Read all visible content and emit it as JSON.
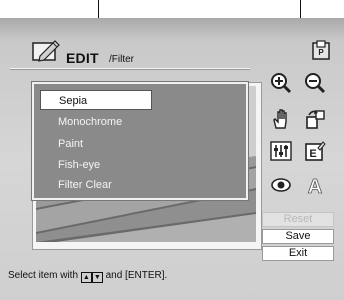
{
  "header": {
    "title": "EDIT",
    "subtitle": "Filter"
  },
  "menu": {
    "items": [
      {
        "label": "Sepia",
        "selected": true
      },
      {
        "label": "Monochrome",
        "selected": false
      },
      {
        "label": "Paint",
        "selected": false
      },
      {
        "label": "Fish-eye",
        "selected": false
      },
      {
        "label": "Filter  Clear",
        "selected": false
      }
    ]
  },
  "tools": [
    {
      "icon": "zoom-in-icon"
    },
    {
      "icon": "zoom-out-icon"
    },
    {
      "icon": "hand-move-icon"
    },
    {
      "icon": "rotate-icon"
    },
    {
      "icon": "adjust-sliders-icon"
    },
    {
      "icon": "filter-edit-icon"
    },
    {
      "icon": "red-eye-icon"
    },
    {
      "icon": "text-icon"
    }
  ],
  "buttons": {
    "reset": "Reset",
    "save": "Save",
    "exit": "Exit"
  },
  "hint": {
    "prefix": "Select item with",
    "suffix": "and [ENTER]."
  },
  "icons": {
    "printer": "printer-icon",
    "logo": "edit-pencil-icon"
  },
  "colors": {
    "menu_bg": "#8a8a8a",
    "screen_bg": "#d6d6d6"
  }
}
